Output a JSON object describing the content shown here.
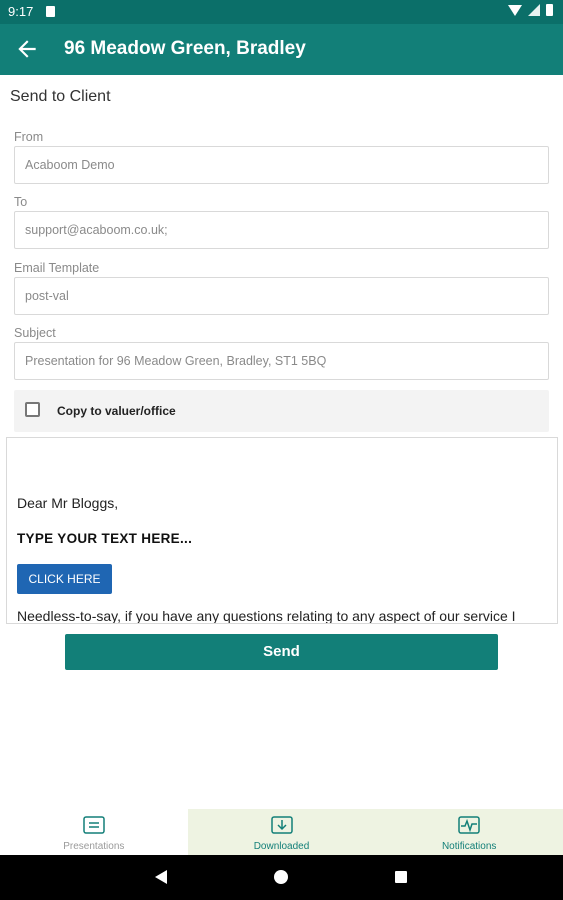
{
  "status_bar": {
    "time": "9:17"
  },
  "app_bar": {
    "title": "96 Meadow Green, Bradley"
  },
  "form": {
    "section_title": "Send to Client",
    "from_label": "From",
    "from_value": "Acaboom Demo",
    "to_label": "To",
    "to_value": "support@acaboom.co.uk;",
    "template_label": "Email Template",
    "template_value": "post-val",
    "subject_label": "Subject",
    "subject_value": "Presentation for 96 Meadow Green, Bradley, ST1 5BQ",
    "copy_label": "Copy to valuer/office",
    "copy_checked": false
  },
  "email_body": {
    "greeting": "Dear Mr Bloggs,",
    "placeholder_text": "TYPE YOUR TEXT HERE...",
    "click_here_label": "CLICK HERE",
    "paragraph": "Needless-to-say, if you have any questions relating to any aspect of our service I"
  },
  "send_button_label": "Send",
  "bottom_nav": {
    "items": [
      {
        "label": "Presentations",
        "icon": "presentation-icon",
        "active": true
      },
      {
        "label": "Downloaded",
        "icon": "download-icon",
        "active": false
      },
      {
        "label": "Notifications",
        "icon": "activity-icon",
        "active": false
      }
    ]
  },
  "colors": {
    "primary": "#127f78",
    "status_bar": "#0b6f69",
    "link_button": "#1f66b3",
    "nav_inactive_bg": "#eef3e2"
  }
}
